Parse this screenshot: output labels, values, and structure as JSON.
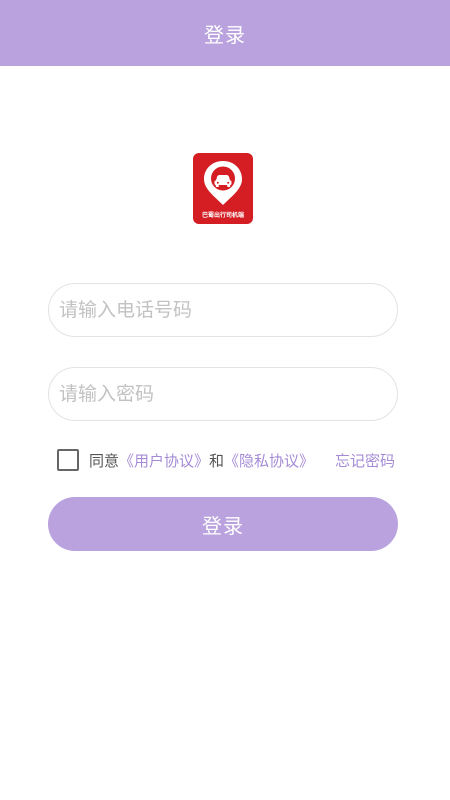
{
  "colors": {
    "accent": "#b9a2dd",
    "link": "#a58bd6",
    "logo_red": "#d41e23"
  },
  "header": {
    "title": "登录"
  },
  "logo": {
    "icon": "car-location-pin-icon",
    "text": "巴蜀出行司机端"
  },
  "form": {
    "phone_placeholder": "请输入电话号码",
    "phone_value": "",
    "password_placeholder": "请输入密码",
    "password_value": ""
  },
  "agreement": {
    "checked": false,
    "prefix": "同意",
    "user_agreement": "《用户协议》",
    "conjunction": "和",
    "privacy_agreement": "《隐私协议》",
    "forgot_password": "忘记密码"
  },
  "login_button": {
    "label": "登录"
  }
}
